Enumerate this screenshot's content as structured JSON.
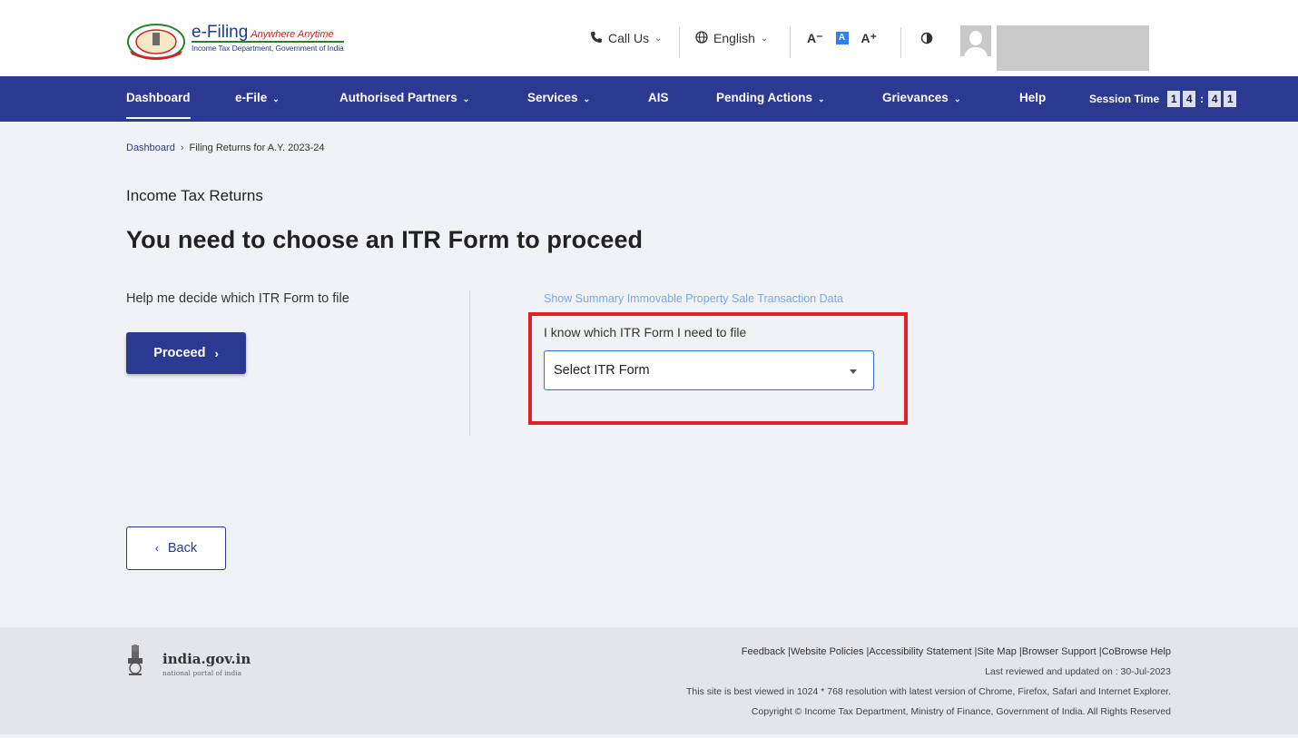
{
  "header": {
    "logo_title": "e-Filing",
    "logo_tagline": "Anywhere Anytime",
    "logo_subtitle": "Income Tax Department, Government of India",
    "call_us": "Call Us",
    "language": "English",
    "font_decrease": "A⁻",
    "font_normal": "A",
    "font_increase": "A⁺",
    "icons": {
      "phone": "phone-icon",
      "globe": "globe-icon",
      "contrast": "contrast-icon",
      "avatar": "avatar-icon"
    }
  },
  "nav": {
    "items": [
      {
        "label": "Dashboard",
        "active": true
      },
      {
        "label": "e-File"
      },
      {
        "label": "Authorised Partners"
      },
      {
        "label": "Services"
      },
      {
        "label": "AIS"
      },
      {
        "label": "Pending Actions"
      },
      {
        "label": "Grievances"
      },
      {
        "label": "Help"
      }
    ],
    "session_label": "Session Time",
    "session_digits": [
      "1",
      "4",
      "4",
      "1"
    ],
    "session_separator": ":"
  },
  "breadcrumb": {
    "home": "Dashboard",
    "separator": "›",
    "current": "Filing Returns for A.Y. 2023-24"
  },
  "main": {
    "section_label": "Income Tax Returns",
    "title": "You need to choose an ITR Form to proceed",
    "help_text": "Help me decide which ITR Form to file",
    "proceed_label": "Proceed",
    "proceed_arrow": "›",
    "summary_link": "Show Summary Immovable Property Sale Transaction Data",
    "itr_label": "I know which ITR Form I need to file",
    "itr_select_value": "Select ITR Form",
    "back_arrow": "‹",
    "back_label": "Back"
  },
  "footer": {
    "gov_name": "india.gov.in",
    "gov_sub": "national portal of india",
    "links": "Feedback |Website Policies |Accessibility Statement |Site Map |Browser Support |CoBrowse Help",
    "last_reviewed": "Last reviewed and updated on : 30-Jul-2023",
    "best_viewed": "This site is best viewed in 1024 * 768 resolution with latest version of Chrome, Firefox, Safari and Internet Explorer.",
    "copyright": "Copyright © Income Tax Department, Ministry of Finance, Government of India. All Rights Reserved"
  },
  "colors": {
    "nav_bg": "#2b3990",
    "highlight_border": "#e0202a",
    "link": "#78a9e0",
    "page_bg": "#f1f2f6"
  }
}
